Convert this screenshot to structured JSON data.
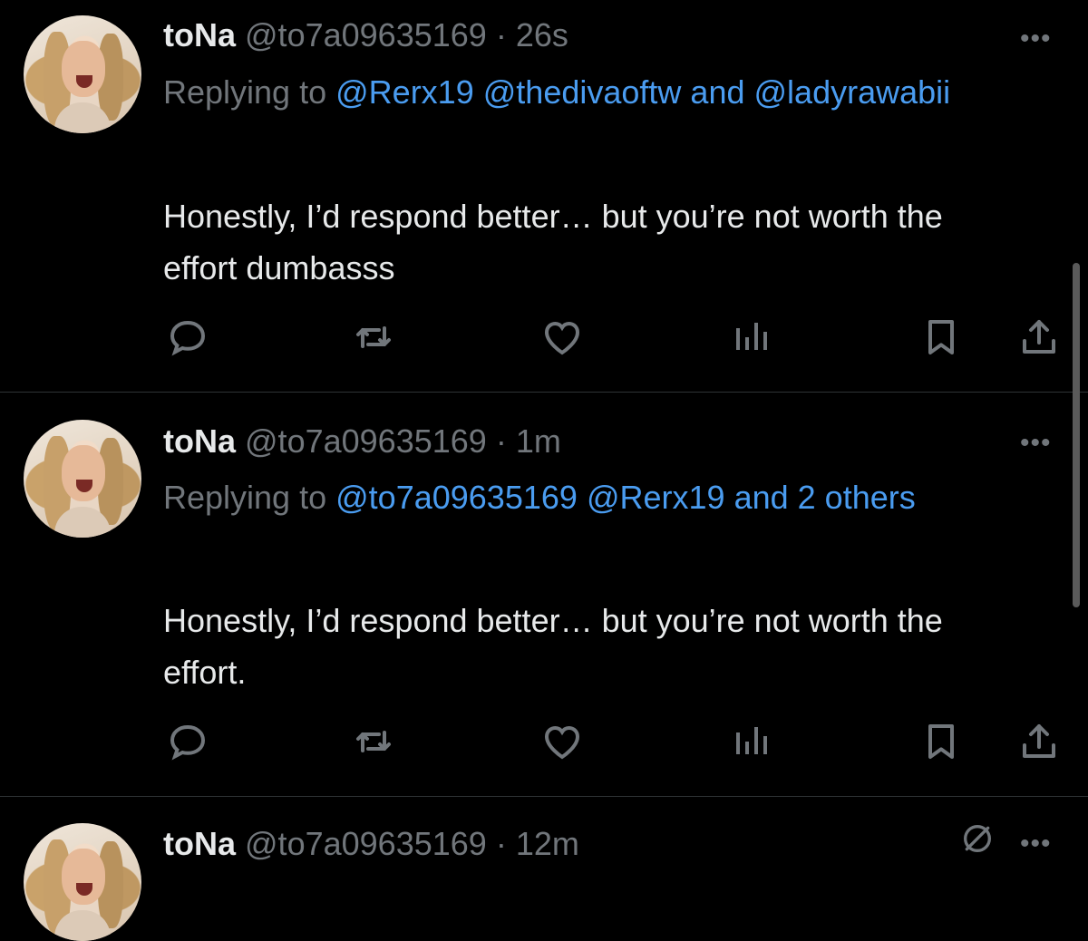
{
  "tweets": [
    {
      "name": "toNa",
      "handle": "@to7a09635169",
      "sep": "·",
      "time": "26s",
      "replying_prefix": "Replying to",
      "mentions": [
        "@Rerx19",
        "@thedivaoftw",
        "and",
        "@ladyrawabii"
      ],
      "text": "Honestly, I’d respond better… but you’re not worth the effort dumbasss",
      "more_label": "•••"
    },
    {
      "name": "toNa",
      "handle": "@to7a09635169",
      "sep": "·",
      "time": "1m",
      "replying_prefix": "Replying to",
      "mentions": [
        "@to7a09635169",
        "@Rerx19",
        "and 2",
        "others"
      ],
      "text": "Honestly, I’d respond better… but you’re not worth the effort.",
      "more_label": "•••"
    },
    {
      "name": "toNa",
      "handle": "@to7a09635169",
      "sep": "·",
      "time": "12m",
      "more_label": "•••"
    }
  ],
  "icons": {
    "reply": "reply-icon",
    "retweet": "retweet-icon",
    "like": "heart-icon",
    "views": "analytics-icon",
    "bookmark": "bookmark-icon",
    "share": "share-icon",
    "more": "more-icon",
    "muted": "slash-circle-icon"
  },
  "colors": {
    "background": "#000000",
    "text": "#e7e9ea",
    "secondary": "#71767b",
    "link": "#4a9cf0",
    "divider": "#2f3336"
  }
}
